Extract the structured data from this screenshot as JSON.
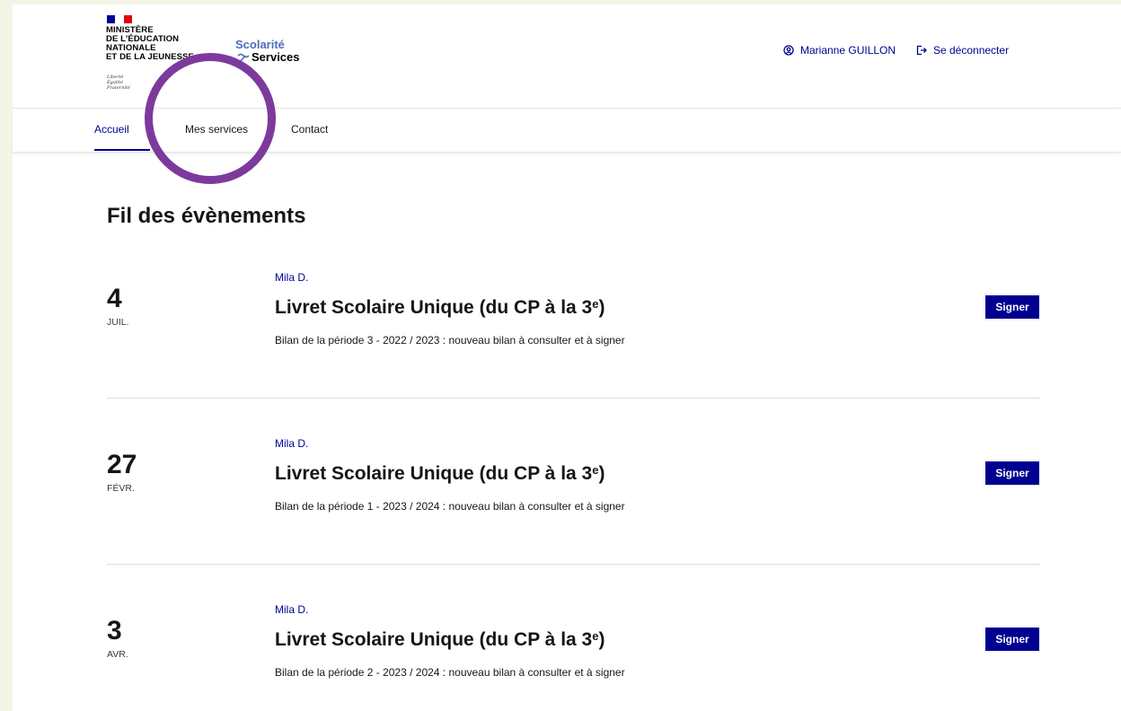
{
  "colors": {
    "accent": "#000091",
    "highlight_ring": "#7d3a9c",
    "flag_blue": "#000091",
    "flag_red": "#e1000f",
    "background": "#f5f5e6"
  },
  "header": {
    "ministry_lines": [
      "MINISTÈRE",
      "DE L'ÉDUCATION",
      "NATIONALE",
      "ET DE LA JEUNESSE"
    ],
    "devise_lines": [
      "Liberté",
      "Égalité",
      "Fraternité"
    ],
    "brand_line1": "Scolarité",
    "brand_line2": "Services",
    "user_name": "Marianne GUILLON",
    "user_icon": "account-circle-icon",
    "logout_label": "Se déconnecter",
    "logout_icon": "logout-icon"
  },
  "nav": {
    "items": [
      {
        "label": "Accueil"
      },
      {
        "label": "Mes services"
      },
      {
        "label": "Contact"
      }
    ],
    "active": "Accueil"
  },
  "feed": {
    "title": "Fil des évènements",
    "events": [
      {
        "day": "4",
        "month": "JUIL.",
        "child": "Mila D.",
        "title": "Livret Scolaire Unique (du CP à la 3",
        "title_sup": "e",
        "title_end": ")",
        "description": "Bilan de la période 3 - 2022 / 2023 : nouveau bilan à consulter et à signer",
        "action": "Signer"
      },
      {
        "day": "27",
        "month": "FÉVR.",
        "child": "Mila D.",
        "title": "Livret Scolaire Unique (du CP à la 3",
        "title_sup": "e",
        "title_end": ")",
        "description": "Bilan de la période 1 - 2023 / 2024 : nouveau bilan à consulter et à signer",
        "action": "Signer"
      },
      {
        "day": "3",
        "month": "AVR.",
        "child": "Mila D.",
        "title": "Livret Scolaire Unique (du CP à la 3",
        "title_sup": "e",
        "title_end": ")",
        "description": "Bilan de la période 2 - 2023 / 2024 : nouveau bilan à consulter et à signer",
        "action": "Signer"
      }
    ]
  }
}
